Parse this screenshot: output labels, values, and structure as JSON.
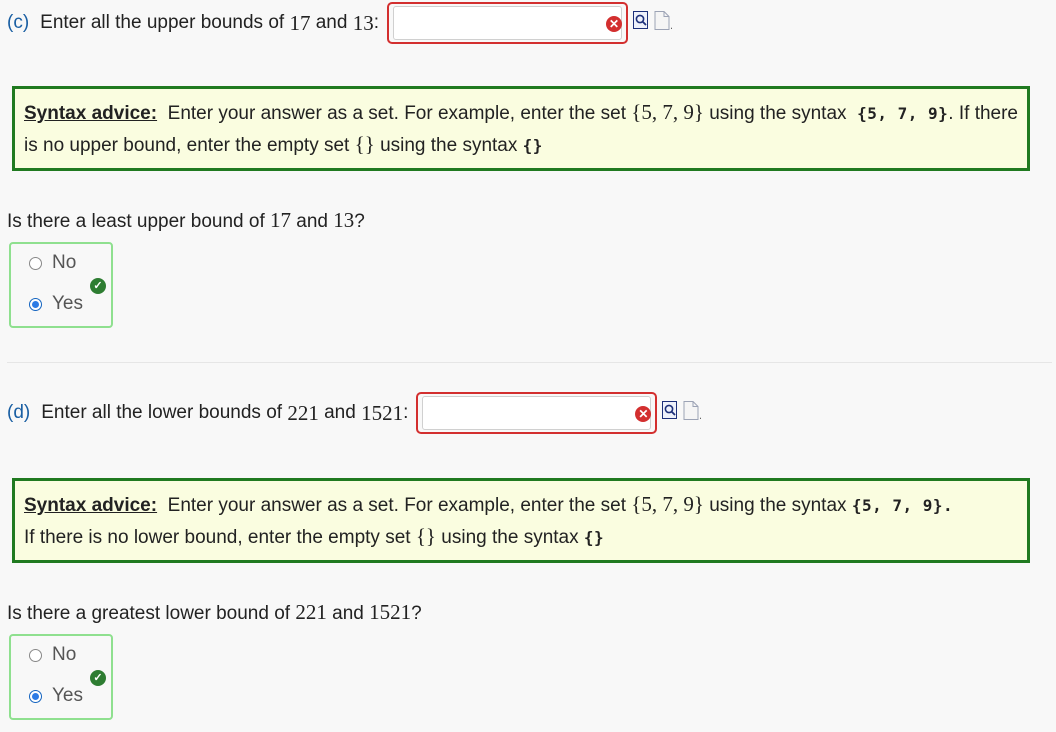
{
  "part_c": {
    "label": "(c)",
    "prompt_pre": "Enter all the upper bounds of",
    "num_a": "17",
    "conj": "and",
    "num_b": "13",
    "colon": ":",
    "input_value": "",
    "advice": {
      "label": "Syntax advice:",
      "t1": "Enter your answer as a set. For example, enter the set",
      "set_math": "{5, 7, 9}",
      "t2": "using the syntax",
      "set_syntax": "{5, 7, 9}",
      "t3": ". If there is no upper bound, enter the empty set",
      "empty_math": "{}",
      "t4": "using the syntax",
      "empty_syntax": "{}"
    },
    "question_pre": "Is there a least upper bound of",
    "q_num_a": "17",
    "q_conj": "and",
    "q_num_b": "13",
    "q_mark": "?",
    "options": [
      "No",
      "Yes"
    ],
    "selected": "Yes"
  },
  "part_d": {
    "label": "(d)",
    "prompt_pre": "Enter all the lower bounds of",
    "num_a": "221",
    "conj": "and",
    "num_b": "1521",
    "colon": ":",
    "input_value": "",
    "advice": {
      "label": "Syntax advice:",
      "t1": "Enter your answer as a set. For example, enter the set",
      "set_math": "{5, 7, 9}",
      "t2": "using the syntax",
      "set_syntax": "{5, 7, 9}.",
      "t3": "If there is no lower bound, enter the empty set",
      "empty_math": "{}",
      "t4": "using the syntax",
      "empty_syntax": "{}"
    },
    "question_pre": "Is there a greatest lower bound of",
    "q_num_a": "221",
    "q_conj": "and",
    "q_num_b": "1521",
    "q_mark": "?",
    "options": [
      "No",
      "Yes"
    ],
    "selected": "Yes"
  },
  "colors": {
    "error": "#d32f2f",
    "correct": "#2e7d32",
    "advice_border": "#207a20",
    "part_label": "#1a5fa3"
  },
  "icons": [
    "error-x-icon",
    "preview-magnifier-icon",
    "document-icon",
    "check-icon"
  ]
}
